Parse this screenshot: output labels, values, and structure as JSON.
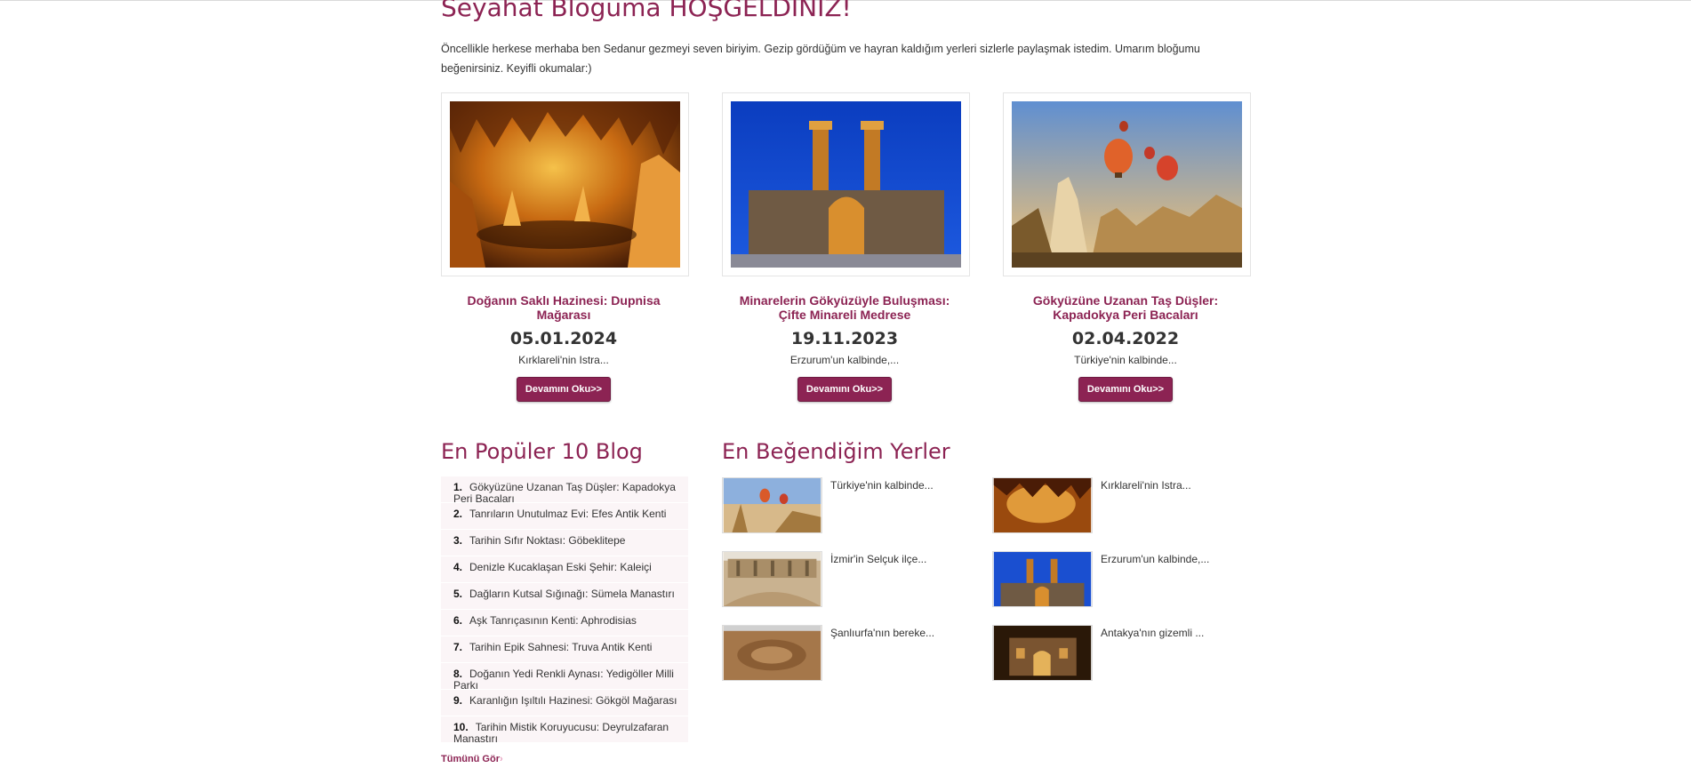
{
  "header": {
    "title": "Seyahat Bloguma HOŞGELDİNİZ!",
    "intro": "Öncellikle herkese merhaba ben Sedanur gezmeyi seven biriyim. Gezip gördüğüm ve hayran kaldığım yerleri sizlerle paylaşmak istedim. Umarım bloğumu beğenirsiniz. Keyifli okumalar:)"
  },
  "cards": [
    {
      "title": "Doğanın Saklı Hazinesi: Dupnisa Mağarası",
      "date": "05.01.2024",
      "excerpt": "Kırklareli'nin Istra...",
      "button": "Devamını Oku>>",
      "image_icon": "cave-image"
    },
    {
      "title": "Minarelerin Gökyüzüyle Buluşması: Çifte Minareli Medrese",
      "date": "19.11.2023",
      "excerpt": "Erzurum'un kalbinde,...",
      "button": "Devamını Oku>>",
      "image_icon": "minaret-madrasa-image"
    },
    {
      "title": "Gökyüzüne Uzanan Taş Düşler: Kapadokya Peri Bacaları",
      "date": "02.04.2022",
      "excerpt": "Türkiye'nin kalbinde...",
      "button": "Devamını Oku>>",
      "image_icon": "cappadocia-balloons-image"
    }
  ],
  "popular": {
    "heading": "En Popüler 10 Blog",
    "items": [
      {
        "num": "1.",
        "label": "Gökyüzüne Uzanan Taş Düşler: Kapadokya Peri Bacaları"
      },
      {
        "num": "2.",
        "label": "Tanrıların Unutulmaz Evi: Efes Antik Kenti"
      },
      {
        "num": "3.",
        "label": "Tarihin Sıfır Noktası: Göbeklitepe"
      },
      {
        "num": "4.",
        "label": "Denizle Kucaklaşan Eski Şehir: Kaleiçi"
      },
      {
        "num": "5.",
        "label": "Dağların Kutsal Sığınağı: Sümela Manastırı"
      },
      {
        "num": "6.",
        "label": "Aşk Tanrıçasının Kenti: Aphrodisias"
      },
      {
        "num": "7.",
        "label": "Tarihin Epik Sahnesi: Truva Antik Kenti"
      },
      {
        "num": "8.",
        "label": "Doğanın Yedi Renkli Aynası: Yedigöller Milli Parkı"
      },
      {
        "num": "9.",
        "label": "Karanlığın Işıltılı Hazinesi: Gökgöl Mağarası"
      },
      {
        "num": "10.",
        "label": "Tarihin Mistik Koruyucusu: Deyrulzafaran Manastırı"
      }
    ],
    "see_all": "Tümünü Gör",
    "see_all_arrow": "›"
  },
  "favorites": {
    "heading": "En Beğendiğim Yerler",
    "items": [
      {
        "text": "Türkiye'nin kalbinde...",
        "image_icon": "cappadocia-image"
      },
      {
        "text": "Kırklareli'nin Istra...",
        "image_icon": "cave-image"
      },
      {
        "text": "İzmir'in Selçuk ilçe...",
        "image_icon": "ephesus-theatre-image"
      },
      {
        "text": "Erzurum'un kalbinde,...",
        "image_icon": "minaret-madrasa-image"
      },
      {
        "text": "Şanlıurfa'nın bereke...",
        "image_icon": "gobeklitepe-image"
      },
      {
        "text": "Antakya'nın gizemli ...",
        "image_icon": "cave-church-image"
      }
    ]
  },
  "colors": {
    "accent": "#8c2353",
    "list_bg": "#fbf5f7",
    "text": "#333333"
  }
}
